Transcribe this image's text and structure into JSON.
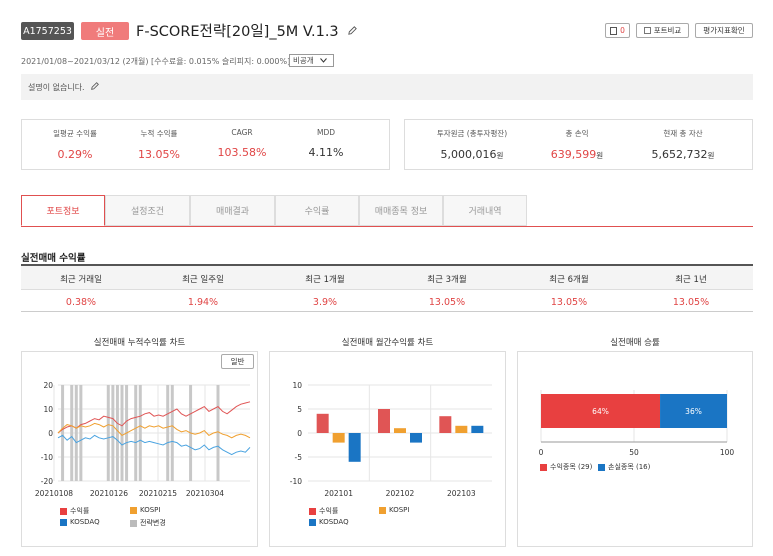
{
  "header": {
    "strategy_id": "A1757253",
    "mode": "실전",
    "title": "F-SCORE전략[20일]_5M V.1.3",
    "doc_count": "0",
    "compare_label": "포트비교",
    "eval_label": "평가지표확인",
    "meta": "2021/01/08~2021/03/12 (2개월) [수수료율: 0.015% 슬리피지: 0.000%]",
    "visibility": "비공개",
    "description": "설명이 없습니다."
  },
  "stats_left": [
    {
      "label": "일평균 수익률",
      "value": "0.29%"
    },
    {
      "label": "누적 수익률",
      "value": "13.05%"
    },
    {
      "label": "CAGR",
      "value": "103.58%"
    },
    {
      "label": "MDD",
      "value": "4.11%"
    }
  ],
  "stats_right": [
    {
      "label": "투자원금 (총투자평잔)",
      "value": "5,000,016",
      "unit": "원"
    },
    {
      "label": "총 손익",
      "value": "639,599",
      "unit": "원"
    },
    {
      "label": "현재 총 자산",
      "value": "5,652,732",
      "unit": "원"
    }
  ],
  "tabs": [
    "포트정보",
    "설정조건",
    "매매결과",
    "수익률",
    "매매종목 정보",
    "거래내역"
  ],
  "returns": {
    "title": "실전매매 수익률",
    "headers": [
      "최근 거래일",
      "최근 일주일",
      "최근 1개월",
      "최근 3개월",
      "최근 6개월",
      "최근 1년"
    ],
    "values": [
      "0.38%",
      "1.94%",
      "3.9%",
      "13.05%",
      "13.05%",
      "13.05%"
    ]
  },
  "charts": {
    "cumulative": {
      "title": "실전매매 누적수익률 차트",
      "button": "일반",
      "yticks": [
        "20",
        "10",
        "0",
        "-10",
        "-20"
      ],
      "xticks": [
        "20210108",
        "20210126",
        "20210215",
        "20210304"
      ],
      "legend": [
        "수익률",
        "KOSPI",
        "KOSDAQ",
        "전략변경"
      ]
    },
    "monthly": {
      "title": "실전매매 월간수익률 차트",
      "yticks": [
        "10",
        "5",
        "0",
        "-5",
        "-10"
      ],
      "legend": [
        "수익률",
        "KOSPI",
        "KOSDAQ"
      ]
    },
    "winrate": {
      "title": "실전매매 승률",
      "win_label": "64%",
      "loss_label": "36%",
      "xticks": [
        "0",
        "50",
        "100"
      ],
      "legend": [
        "수익종목 (29)",
        "손실종목 (16)"
      ]
    }
  },
  "chart_data": [
    {
      "type": "line",
      "title": "실전매매 누적수익률 차트",
      "ylim": [
        -20,
        20
      ],
      "x": [
        "20210108",
        "20210111",
        "20210112",
        "20210113",
        "20210114",
        "20210115",
        "20210118",
        "20210119",
        "20210120",
        "20210121",
        "20210122",
        "20210125",
        "20210126",
        "20210127",
        "20210128",
        "20210129",
        "20210201",
        "20210202",
        "20210203",
        "20210204",
        "20210205",
        "20210208",
        "20210209",
        "20210210",
        "20210215",
        "20210216",
        "20210217",
        "20210218",
        "20210219",
        "20210222",
        "20210223",
        "20210224",
        "20210225",
        "20210226",
        "20210302",
        "20210303",
        "20210304",
        "20210305",
        "20210308",
        "20210309",
        "20210310",
        "20210311",
        "20210312"
      ],
      "series": [
        {
          "name": "수익률",
          "color": "#e05555",
          "values": [
            0,
            1.5,
            2.5,
            3,
            2,
            3.5,
            4,
            5,
            6,
            5.5,
            7,
            6.5,
            6,
            4,
            3,
            5,
            6,
            6.5,
            7,
            8,
            8.5,
            7,
            7.5,
            7,
            8,
            9,
            10,
            8,
            7,
            8,
            9,
            10,
            11,
            9,
            10,
            11,
            9,
            8,
            9.5,
            11,
            12,
            12.5,
            13
          ]
        },
        {
          "name": "KOSPI",
          "color": "#f0a030",
          "values": [
            0,
            2,
            3.5,
            3,
            2,
            3,
            2.5,
            3,
            4,
            3.5,
            2.5,
            3.5,
            3,
            1,
            -1,
            0,
            1,
            2,
            3,
            2,
            3,
            2.5,
            3,
            2,
            2.5,
            3,
            1.5,
            0.5,
            1,
            0,
            -0.5,
            0,
            1,
            -1,
            0,
            0.5,
            -0.5,
            -1,
            -2,
            -1,
            -0.5,
            -1,
            -2
          ]
        },
        {
          "name": "KOSDAQ",
          "color": "#4aa3e0",
          "values": [
            -2,
            -1,
            -3,
            -1.5,
            -4,
            -3,
            -2,
            -2.5,
            -1,
            -2,
            -2.5,
            -2,
            -1.5,
            -3,
            -5,
            -4,
            -3.5,
            -4,
            -3,
            -4,
            -3.5,
            -4,
            -4.5,
            -5,
            -4,
            -3.5,
            -4,
            -5.5,
            -5,
            -6,
            -7,
            -6.5,
            -5,
            -7,
            -6,
            -5.5,
            -7,
            -8,
            -9,
            -8,
            -7.5,
            -8,
            -6
          ]
        }
      ],
      "strategy_change_x": [
        "20210111",
        "20210113",
        "20210114",
        "20210115",
        "20210125",
        "20210126",
        "20210127",
        "20210128",
        "20210129",
        "20210202",
        "20210203",
        "20210215",
        "20210216",
        "20210222",
        "20210303"
      ]
    },
    {
      "type": "bar",
      "title": "실전매매 월간수익률 차트",
      "ylim": [
        -10,
        10
      ],
      "categories": [
        "202101",
        "202102",
        "202103"
      ],
      "series": [
        {
          "name": "수익률",
          "color": "#e05555",
          "values": [
            4,
            5,
            3.5
          ]
        },
        {
          "name": "KOSPI",
          "color": "#f0a030",
          "values": [
            -2,
            1,
            1.5
          ]
        },
        {
          "name": "KOSDAQ",
          "color": "#1a75c4",
          "values": [
            -6,
            -2,
            1.5
          ]
        }
      ]
    },
    {
      "type": "bar",
      "title": "실전매매 승률",
      "xlim": [
        0,
        100
      ],
      "series": [
        {
          "name": "수익종목 (29)",
          "color": "#e84040",
          "values": [
            64
          ]
        },
        {
          "name": "손실종목 (16)",
          "color": "#1a75c4",
          "values": [
            36
          ]
        }
      ]
    }
  ]
}
